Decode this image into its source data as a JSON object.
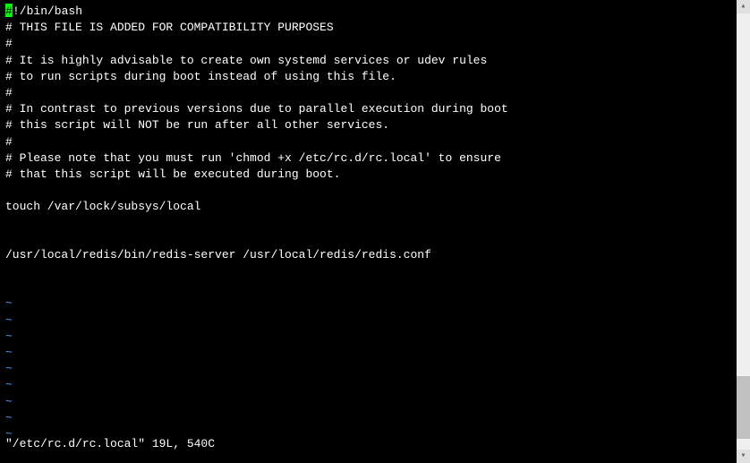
{
  "file_content": {
    "line1_first_char": "#",
    "line1_rest": "!/bin/bash",
    "line2": "# THIS FILE IS ADDED FOR COMPATIBILITY PURPOSES",
    "line3": "#",
    "line4": "# It is highly advisable to create own systemd services or udev rules",
    "line5": "# to run scripts during boot instead of using this file.",
    "line6": "#",
    "line7": "# In contrast to previous versions due to parallel execution during boot",
    "line8": "# this script will NOT be run after all other services.",
    "line9": "#",
    "line10": "# Please note that you must run 'chmod +x /etc/rc.d/rc.local' to ensure",
    "line11": "# that this script will be executed during boot.",
    "line12": "",
    "line13": "touch /var/lock/subsys/local",
    "line14": "",
    "line15": "",
    "line16": "/usr/local/redis/bin/redis-server /usr/local/redis/redis.conf",
    "line17": "",
    "line18": ""
  },
  "tilde": "~",
  "status_line": "\"/etc/rc.d/rc.local\" 19L, 540C",
  "scrollbar": {
    "arrow_up": "▴",
    "arrow_down": "▾"
  }
}
